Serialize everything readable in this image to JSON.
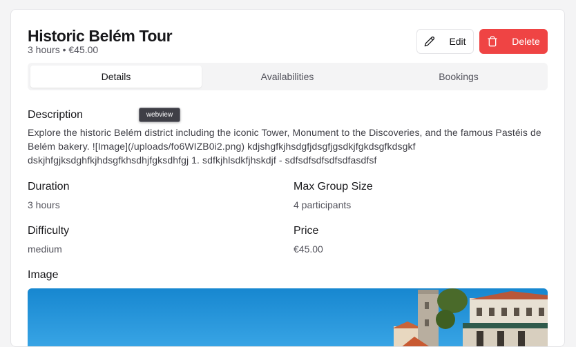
{
  "tour": {
    "title": "Historic Belém Tour",
    "subtitle": "3 hours • €45.00"
  },
  "actions": {
    "edit_label": "Edit",
    "delete_label": "Delete"
  },
  "tabs": [
    {
      "label": "Details",
      "active": true
    },
    {
      "label": "Availabilities",
      "active": false
    },
    {
      "label": "Bookings",
      "active": false
    }
  ],
  "tooltip": "webview",
  "details": {
    "description_label": "Description",
    "description": "Explore the historic Belém district including the iconic Tower, Monument to the Discoveries, and the famous Pastéis de Belém bakery. ![Image](/uploads/fo6WIZB0i2.png) kdjshgfkjhsdgfjdsgfjgsdkjfgkdsgfkdsgkf dskjhfgjksdghfkjhdsgfkhsdhjfgksdhfgj 1. sdfkjhlsdkfjhskdjf - sdfsdfsdfsdfsdfasdfsf",
    "duration_label": "Duration",
    "duration": "3 hours",
    "max_group_label": "Max Group Size",
    "max_group": "4 participants",
    "difficulty_label": "Difficulty",
    "difficulty": "medium",
    "price_label": "Price",
    "price": "€45.00",
    "image_label": "Image"
  },
  "colors": {
    "delete": "#ef4444",
    "tab_bg": "#f4f4f5",
    "sky": "#1e8fd6"
  },
  "icons": [
    "pencil-icon",
    "trash-icon"
  ]
}
